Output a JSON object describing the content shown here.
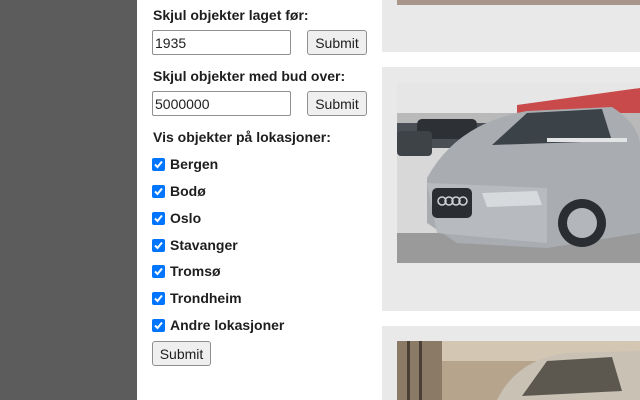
{
  "filters": {
    "hide_before": {
      "label": "Skjul objekter laget før:",
      "value": "1935",
      "submit": "Submit"
    },
    "hide_bid_over": {
      "label": "Skjul objekter med bud over:",
      "value": "5000000",
      "submit": "Submit"
    },
    "locations": {
      "label": "Vis objekter på lokasjoner:",
      "items": [
        {
          "label": "Bergen",
          "checked": true
        },
        {
          "label": "Bodø",
          "checked": true
        },
        {
          "label": "Oslo",
          "checked": true
        },
        {
          "label": "Stavanger",
          "checked": true
        },
        {
          "label": "Tromsø",
          "checked": true
        },
        {
          "label": "Trondheim",
          "checked": true
        },
        {
          "label": "Andre lokasjoner",
          "checked": true
        }
      ],
      "submit": "Submit"
    }
  },
  "colors": {
    "checkbox": "#0075ff",
    "sidebar": "#5c5c5c",
    "card_bg": "#e9e9e9"
  }
}
